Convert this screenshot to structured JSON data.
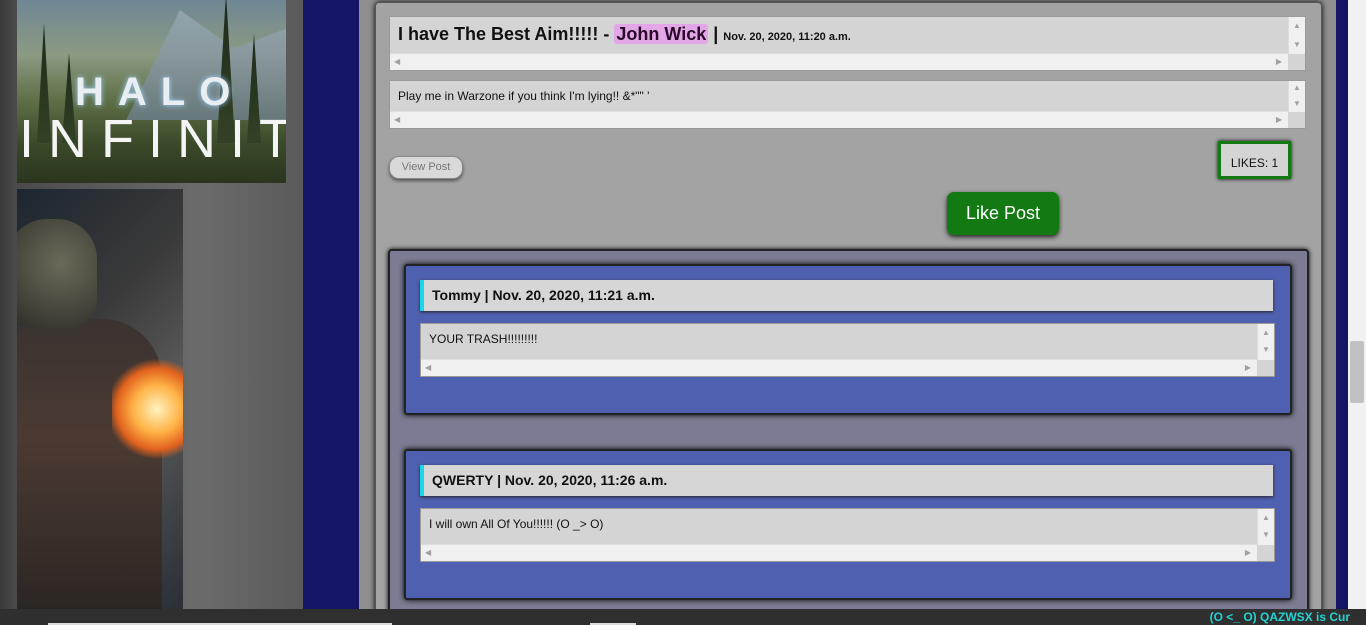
{
  "banner": {
    "halo_word": "HALO",
    "infinite_word": "INFINIT"
  },
  "post": {
    "title": "I have The Best Aim!!!!!",
    "separator": " - ",
    "author": "John Wick",
    "pipe": " | ",
    "date": "Nov. 20, 2020, 11:20 a.m.",
    "body": "Play me in Warzone if you think I'm lying!! &*\"\" '",
    "view_post_label": "View Post",
    "likes_label": "LIKES: 1",
    "like_button_label": "Like Post"
  },
  "comments": [
    {
      "header": "Tommy | Nov. 20, 2020, 11:21 a.m.",
      "body": "YOUR TRASH!!!!!!!!!"
    },
    {
      "header": "QWERTY | Nov. 20, 2020, 11:26 a.m.",
      "body": "I will own All Of You!!!!!! (O _> O)"
    }
  ],
  "ticker": "(O <_ O) QAZWSX is Cur"
}
